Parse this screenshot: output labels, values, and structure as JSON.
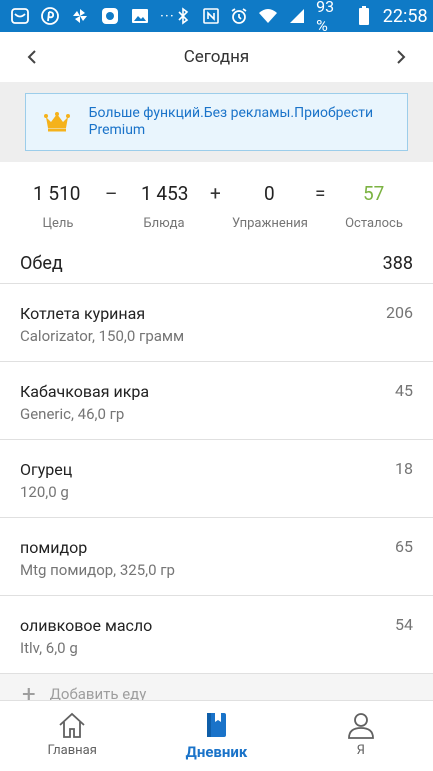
{
  "status": {
    "battery": "93 %",
    "time": "22:58",
    "dots": "···"
  },
  "header": {
    "title": "Сегодня"
  },
  "promo": {
    "text": "Больше функций.Без рекламы.Приобрести Premium"
  },
  "summary": {
    "goal": {
      "value": "1 510",
      "label": "Цель"
    },
    "minus": "–",
    "food": {
      "value": "1 453",
      "label": "Блюда"
    },
    "plus": "+",
    "exercise": {
      "value": "0",
      "label": "Упражнения"
    },
    "equals": "=",
    "remaining": {
      "value": "57",
      "label": "Осталось",
      "color": "#7cb342"
    }
  },
  "meal": {
    "name": "Обед",
    "total": "388",
    "items": [
      {
        "name": "Котлета куриная",
        "desc": "Calorizator, 150,0 грамм",
        "cal": "206"
      },
      {
        "name": "Кабачковая икра",
        "desc": "Generic, 46,0 гр",
        "cal": "45"
      },
      {
        "name": "Огурец",
        "desc": "120,0 g",
        "cal": "18"
      },
      {
        "name": "помидор",
        "desc": "Mtg помидор, 325,0 гр",
        "cal": "65"
      },
      {
        "name": "оливковое масло",
        "desc": "Itlv, 6,0 g",
        "cal": "54"
      }
    ],
    "add_label": "Добавить еду"
  },
  "bottom_nav": {
    "home": "Главная",
    "diary": "Дневник",
    "me": "Я"
  },
  "colors": {
    "accent": "#1a73c9",
    "statusbar": "#0f7ac6",
    "remaining": "#7cb342"
  }
}
